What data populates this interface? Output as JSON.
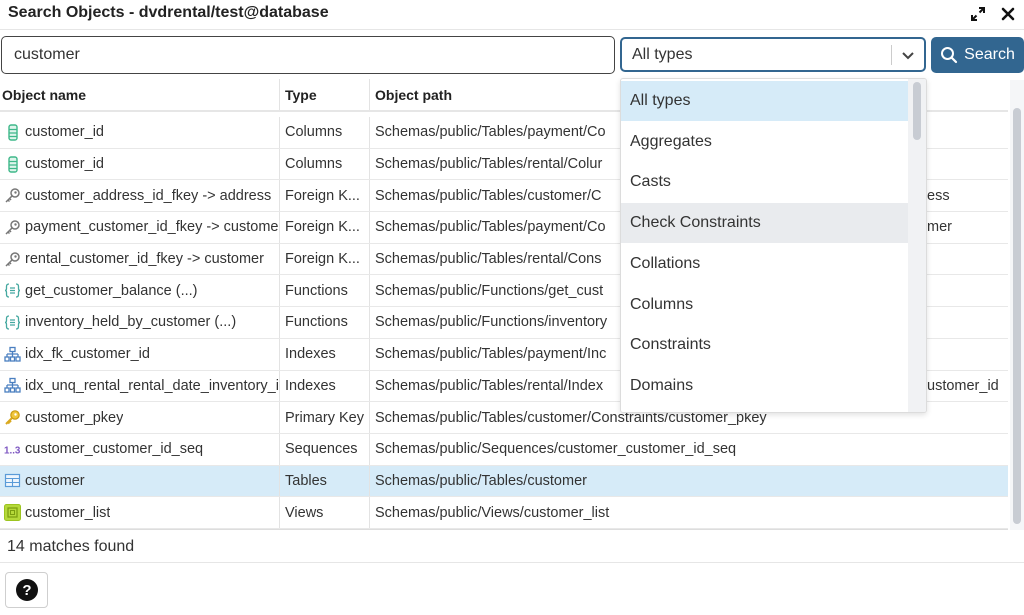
{
  "window": {
    "title": "Search Objects - dvdrental/test@database",
    "maximize_icon": "expand-arrows-icon",
    "close_icon": "close-icon"
  },
  "search": {
    "value": "customer",
    "placeholder": "",
    "type_selected": "All types",
    "button_label": "Search",
    "button_icon": "search-icon"
  },
  "colors": {
    "accent": "#326690",
    "selected_row": "#d6ebf8",
    "hover_option": "#e9ebee"
  },
  "grid": {
    "headers": [
      "Object name",
      "Type",
      "Object path"
    ],
    "rows": [
      {
        "icon": "column-icon",
        "name": "customer_id",
        "type": "Columns",
        "path": "Schemas/public/Tables/payment/Co",
        "path_tail": ""
      },
      {
        "icon": "column-icon",
        "name": "customer_id",
        "type": "Columns",
        "path": "Schemas/public/Tables/rental/Colur",
        "path_tail": ""
      },
      {
        "icon": "foreign-key-icon",
        "name": "customer_address_id_fkey -> address",
        "type": "Foreign K...",
        "path": "Schemas/public/Tables/customer/C",
        "path_tail": "ess"
      },
      {
        "icon": "foreign-key-icon",
        "name": "payment_customer_id_fkey -> custome",
        "type": "Foreign K...",
        "path": "Schemas/public/Tables/payment/Co",
        "path_tail": "mer"
      },
      {
        "icon": "foreign-key-icon",
        "name": "rental_customer_id_fkey -> customer",
        "type": "Foreign K...",
        "path": "Schemas/public/Tables/rental/Cons",
        "path_tail": ""
      },
      {
        "icon": "function-icon",
        "name": "get_customer_balance (...)",
        "type": "Functions",
        "path": "Schemas/public/Functions/get_cust",
        "path_tail": ""
      },
      {
        "icon": "function-icon",
        "name": "inventory_held_by_customer (...)",
        "type": "Functions",
        "path": "Schemas/public/Functions/inventory",
        "path_tail": ""
      },
      {
        "icon": "index-icon",
        "name": "idx_fk_customer_id",
        "type": "Indexes",
        "path": "Schemas/public/Tables/payment/Inc",
        "path_tail": ""
      },
      {
        "icon": "index-icon",
        "name": "idx_unq_rental_rental_date_inventory_i",
        "type": "Indexes",
        "path": "Schemas/public/Tables/rental/Index",
        "path_tail": "ustomer_id"
      },
      {
        "icon": "primary-key-icon",
        "name": "customer_pkey",
        "type": "Primary Key",
        "path": "Schemas/public/Tables/customer/Constraints/customer_pkey",
        "path_tail": ""
      },
      {
        "icon": "sequence-icon",
        "name": "customer_customer_id_seq",
        "type": "Sequences",
        "path": "Schemas/public/Sequences/customer_customer_id_seq",
        "path_tail": ""
      },
      {
        "icon": "table-icon",
        "name": "customer",
        "type": "Tables",
        "path": "Schemas/public/Tables/customer",
        "path_tail": "",
        "selected": true
      },
      {
        "icon": "view-icon",
        "name": "customer_list",
        "type": "Views",
        "path": "Schemas/public/Views/customer_list",
        "path_tail": ""
      }
    ]
  },
  "dropdown": {
    "options": [
      "All types",
      "Aggregates",
      "Casts",
      "Check Constraints",
      "Collations",
      "Columns",
      "Constraints",
      "Domains"
    ],
    "selected": "All types",
    "hovered": "Check Constraints"
  },
  "status": {
    "text": "14 matches found"
  },
  "footer": {
    "help_icon": "help-icon"
  }
}
